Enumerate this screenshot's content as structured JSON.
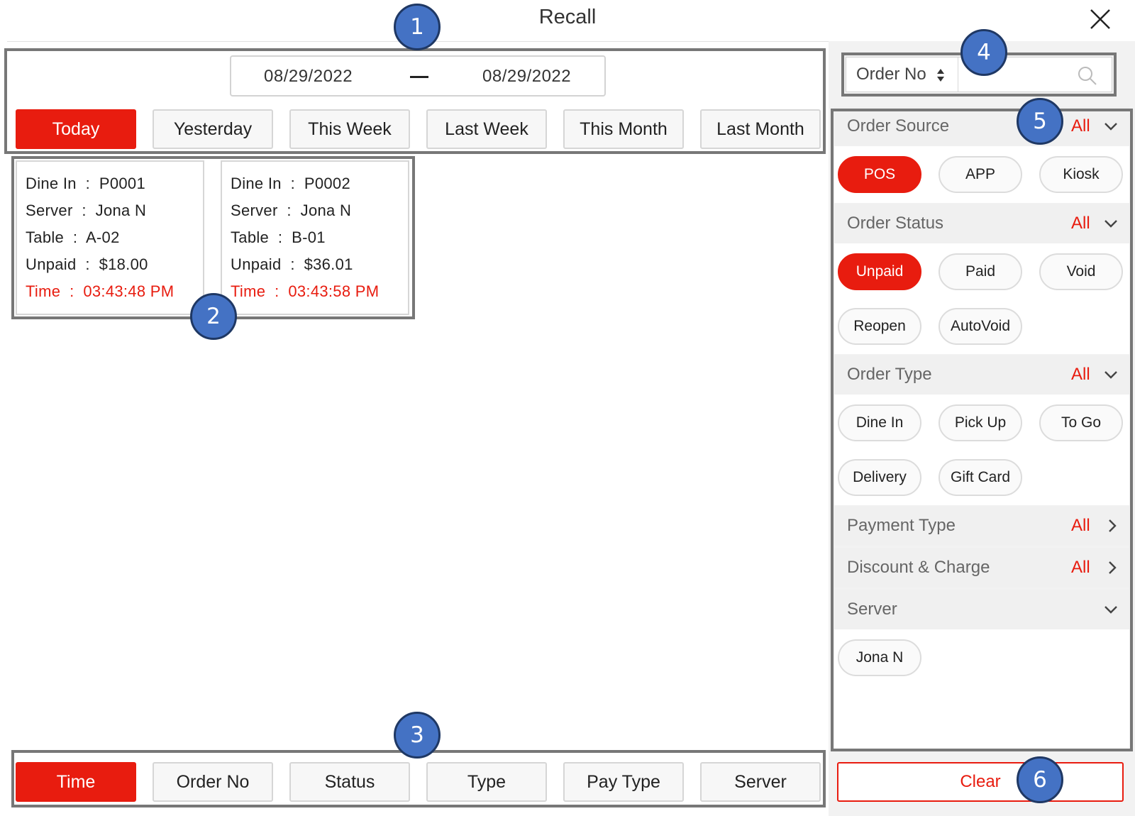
{
  "window": {
    "title": "Recall"
  },
  "date_range": {
    "from": "08/29/2022",
    "to": "08/29/2022"
  },
  "date_presets": [
    {
      "label": "Today",
      "active": true
    },
    {
      "label": "Yesterday",
      "active": false
    },
    {
      "label": "This Week",
      "active": false
    },
    {
      "label": "Last Week",
      "active": false
    },
    {
      "label": "This Month",
      "active": false
    },
    {
      "label": "Last Month",
      "active": false
    }
  ],
  "orders": [
    {
      "type_line": "Dine In  :  P0001",
      "server_line": "Server  :  Jona N",
      "table_line": "Table  :  A-02",
      "unpaid_line": "Unpaid  :  $18.00",
      "time_line": "Time  :  03:43:48 PM"
    },
    {
      "type_line": "Dine In  :  P0002",
      "server_line": "Server  :  Jona N",
      "table_line": "Table  :  B-01",
      "unpaid_line": "Unpaid  :  $36.01",
      "time_line": "Time  :  03:43:58 PM"
    }
  ],
  "sort_options": [
    {
      "label": "Time",
      "active": true
    },
    {
      "label": "Order No",
      "active": false
    },
    {
      "label": "Status",
      "active": false
    },
    {
      "label": "Type",
      "active": false
    },
    {
      "label": "Pay Type",
      "active": false
    },
    {
      "label": "Server",
      "active": false
    }
  ],
  "search": {
    "field": "Order No",
    "value": ""
  },
  "filters": {
    "order_source": {
      "label": "Order Source",
      "value": "All",
      "chips": [
        {
          "label": "POS",
          "active": true
        },
        {
          "label": "APP",
          "active": false
        },
        {
          "label": "Kiosk",
          "active": false
        }
      ]
    },
    "order_status": {
      "label": "Order Status",
      "value": "All",
      "chips": [
        {
          "label": "Unpaid",
          "active": true
        },
        {
          "label": "Paid",
          "active": false
        },
        {
          "label": "Void",
          "active": false
        },
        {
          "label": "Reopen",
          "active": false
        },
        {
          "label": "AutoVoid",
          "active": false
        }
      ]
    },
    "order_type": {
      "label": "Order Type",
      "value": "All",
      "chips": [
        {
          "label": "Dine In",
          "active": false
        },
        {
          "label": "Pick Up",
          "active": false
        },
        {
          "label": "To Go",
          "active": false
        },
        {
          "label": "Delivery",
          "active": false
        },
        {
          "label": "Gift Card",
          "active": false
        }
      ]
    },
    "payment_type": {
      "label": "Payment Type",
      "value": "All"
    },
    "discount_charge": {
      "label": "Discount & Charge",
      "value": "All"
    },
    "server": {
      "label": "Server",
      "chips": [
        {
          "label": "Jona N",
          "active": false
        }
      ]
    }
  },
  "clear_label": "Clear",
  "callouts": [
    "1",
    "2",
    "3",
    "4",
    "5",
    "6"
  ],
  "colors": {
    "accent": "#e81c0f",
    "callout": "#4472c4"
  }
}
